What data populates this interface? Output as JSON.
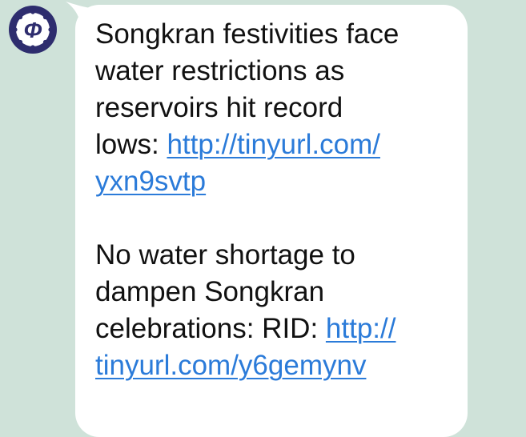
{
  "chat": {
    "sender": {
      "avatar_icon": "stylized-phi-logo-icon",
      "avatar_glyph": "Φ",
      "avatar_color": "#2e2d6e"
    },
    "message": {
      "paragraphs": [
        {
          "text_lines": [
            "Songkran festivities face",
            "water restrictions as",
            "reservoirs hit record",
            "lows: "
          ],
          "link_part1": "http://tinyurl.com/",
          "link_part2": "yxn9svtp"
        },
        {
          "text_lines": [
            "No water shortage to",
            "dampen Songkran",
            "celebrations: RID: "
          ],
          "link_part1": "http://",
          "link_part2": "tinyurl.com/y6gemynv"
        }
      ],
      "link_color": "#2b7bd9",
      "bubble_color": "#ffffff"
    },
    "background_color": "#cfe2d9"
  }
}
